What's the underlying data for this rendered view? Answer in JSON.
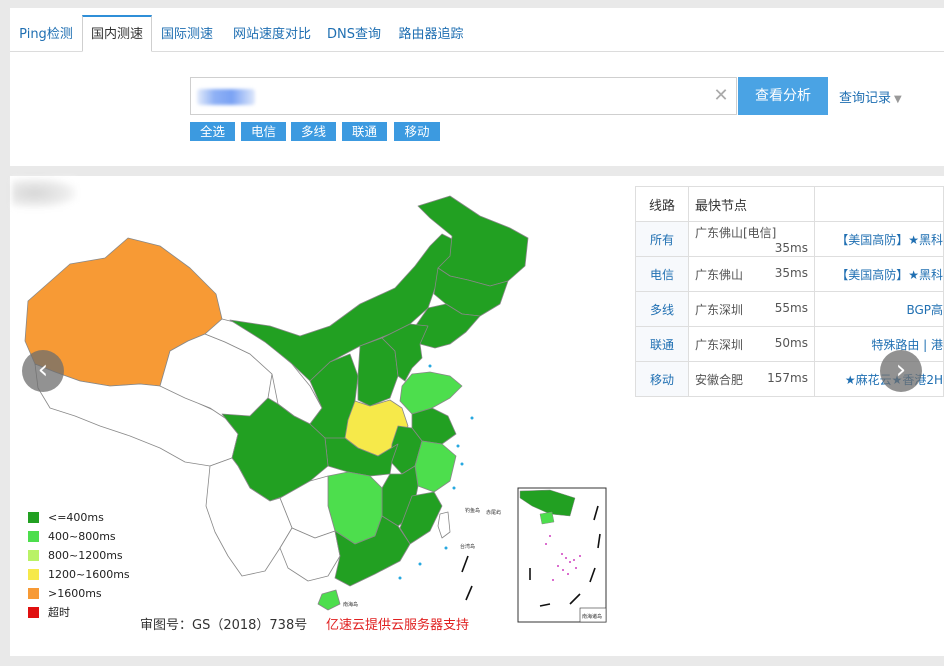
{
  "tabs": [
    {
      "label": "Ping检测",
      "active": false
    },
    {
      "label": "国内测速",
      "active": true
    },
    {
      "label": "国际测速",
      "active": false
    },
    {
      "label": "网站速度对比",
      "active": false
    },
    {
      "label": "DNS查询",
      "active": false
    },
    {
      "label": "路由器追踪",
      "active": false
    }
  ],
  "search": {
    "value": "",
    "submit_label": "查看分析",
    "history_label": "查询记录"
  },
  "isp_buttons": [
    "全选",
    "电信",
    "多线",
    "联通",
    "移动"
  ],
  "legend": [
    {
      "label": "<=400ms",
      "color": "#22a022"
    },
    {
      "label": "400~800ms",
      "color": "#4dde4d"
    },
    {
      "label": "800~1200ms",
      "color": "#b9f266"
    },
    {
      "label": "1200~1600ms",
      "color": "#f6e94a"
    },
    {
      "label": ">1600ms",
      "color": "#f79a35"
    },
    {
      "label": "超时",
      "color": "#e01010"
    }
  ],
  "map": {
    "caption": "审图号：GS（2018）738号",
    "sponsor": "亿速云提供云服务器支持",
    "colors": {
      "green": "#22a022",
      "light_green": "#4dde4d",
      "yellow": "#f6e94a",
      "orange": "#f79a35",
      "white": "#ffffff"
    }
  },
  "table": {
    "headers": [
      "线路",
      "最快节点",
      ""
    ],
    "rows": [
      {
        "line": "所有",
        "node": "广东佛山[电信]",
        "ms": "35ms",
        "sponsor": "【美国高防】★黑科"
      },
      {
        "line": "电信",
        "node": "广东佛山",
        "ms": "35ms",
        "sponsor": "【美国高防】★黑科"
      },
      {
        "line": "多线",
        "node": "广东深圳",
        "ms": "55ms",
        "sponsor": "BGP高"
      },
      {
        "line": "联通",
        "node": "广东深圳",
        "ms": "50ms",
        "sponsor": "特殊路由 | 港"
      },
      {
        "line": "移动",
        "node": "安徽合肥",
        "ms": "157ms",
        "sponsor": "★麻花云★香港2H"
      }
    ]
  }
}
